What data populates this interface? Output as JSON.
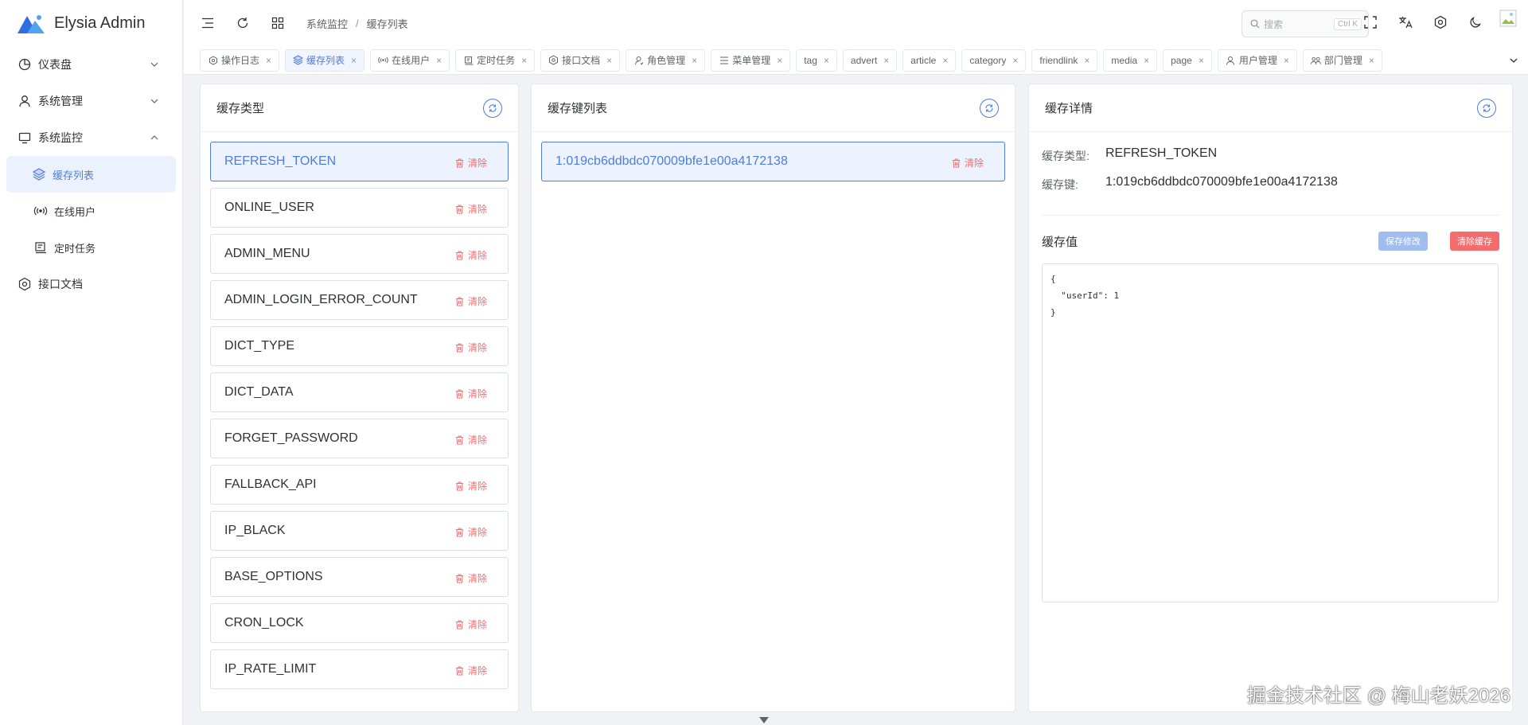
{
  "app": {
    "title": "Elysia Admin"
  },
  "sidebar": {
    "items": [
      {
        "label": "仪表盘",
        "icon": "dashboard-icon",
        "expanded": false
      },
      {
        "label": "系统管理",
        "icon": "user-icon",
        "expanded": false
      },
      {
        "label": "系统监控",
        "icon": "monitor-icon",
        "expanded": true
      },
      {
        "label": "缓存列表",
        "icon": "layers-icon",
        "active": true
      },
      {
        "label": "在线用户",
        "icon": "broadcast-icon"
      },
      {
        "label": "定时任务",
        "icon": "task-icon"
      },
      {
        "label": "接口文档",
        "icon": "api-icon"
      }
    ]
  },
  "header": {
    "breadcrumb": [
      "系统监控",
      "缓存列表"
    ],
    "search_placeholder": "搜索",
    "search_shortcut": "Ctrl K"
  },
  "tabs": [
    {
      "label": "操作日志",
      "icon": "gear-icon"
    },
    {
      "label": "缓存列表",
      "icon": "layers-icon",
      "active": true
    },
    {
      "label": "在线用户",
      "icon": "broadcast-icon"
    },
    {
      "label": "定时任务",
      "icon": "task-icon"
    },
    {
      "label": "接口文档",
      "icon": "api-icon"
    },
    {
      "label": "角色管理",
      "icon": "role-icon"
    },
    {
      "label": "菜单管理",
      "icon": "menu-icon"
    },
    {
      "label": "tag"
    },
    {
      "label": "advert"
    },
    {
      "label": "article"
    },
    {
      "label": "category"
    },
    {
      "label": "friendlink"
    },
    {
      "label": "media"
    },
    {
      "label": "page"
    },
    {
      "label": "用户管理",
      "icon": "user-icon"
    },
    {
      "label": "部门管理",
      "icon": "dept-icon"
    }
  ],
  "type_panel": {
    "title": "缓存类型",
    "delete_label": "清除",
    "items": [
      "REFRESH_TOKEN",
      "ONLINE_USER",
      "ADMIN_MENU",
      "ADMIN_LOGIN_ERROR_COUNT",
      "DICT_TYPE",
      "DICT_DATA",
      "FORGET_PASSWORD",
      "FALLBACK_API",
      "IP_BLACK",
      "BASE_OPTIONS",
      "CRON_LOCK",
      "IP_RATE_LIMIT"
    ]
  },
  "key_panel": {
    "title": "缓存键列表",
    "delete_label": "清除",
    "items": [
      "1:019cb6ddbdc070009bfe1e00a4172138"
    ]
  },
  "detail_panel": {
    "title": "缓存详情",
    "type_label": "缓存类型:",
    "type_value": "REFRESH_TOKEN",
    "key_label": "缓存键:",
    "key_value": "1:019cb6ddbdc070009bfe1e00a4172138",
    "value_label": "缓存值",
    "save_label": "保存修改",
    "clear_label": "清除缓存",
    "value_text": "{\n  \"userId\": 1\n}"
  },
  "watermark": "掘金技术社区 @ 梅山老妖2026",
  "colors": {
    "primary": "#4e7ddc",
    "danger": "#f56c6c",
    "active_bg": "#ecf3fe"
  }
}
